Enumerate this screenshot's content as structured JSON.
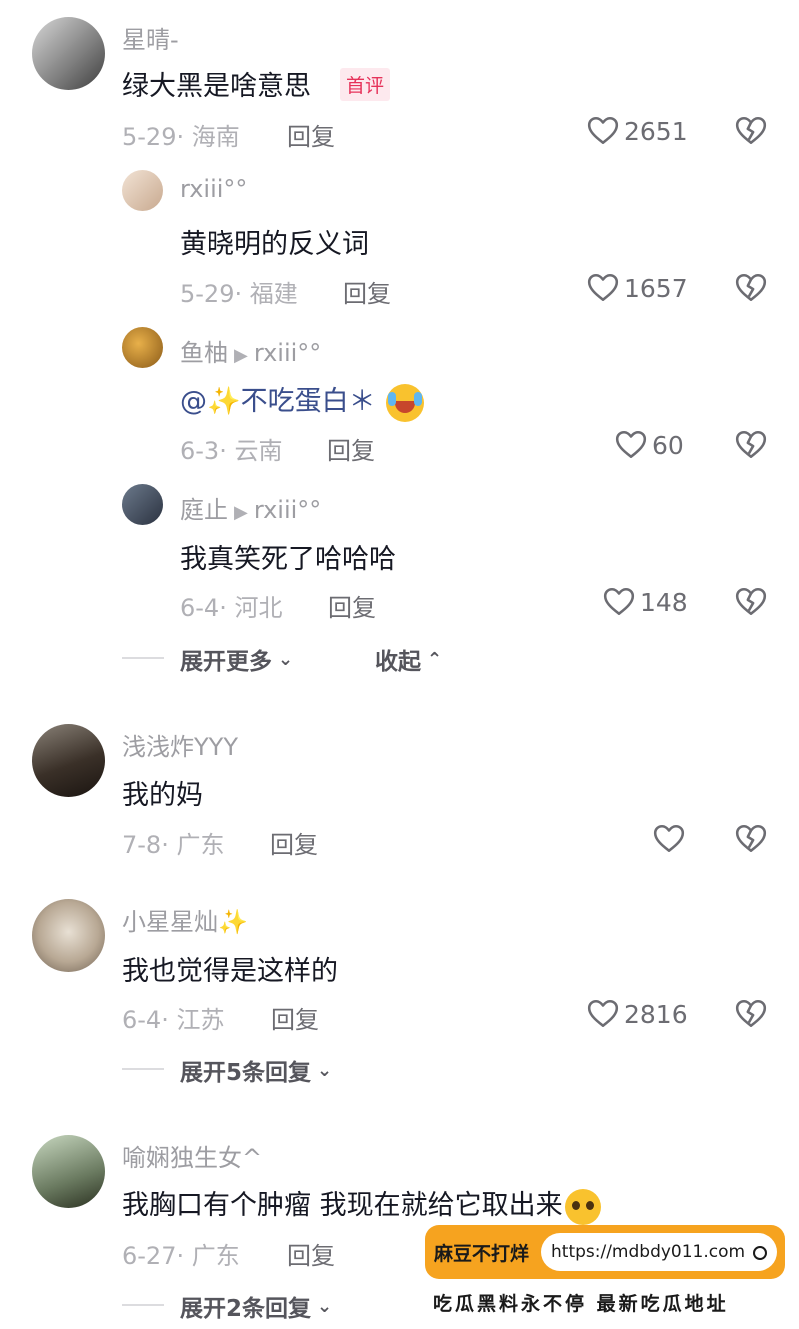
{
  "colors": {
    "accent": "#e6325a",
    "mention": "#3a4e8c",
    "watermark_orange": "#f6a31f"
  },
  "comments": [
    {
      "user": "星晴-",
      "text": "绿大黑是啥意思",
      "tag": "首评",
      "date": "5-29",
      "location": "海南",
      "reply": "回复",
      "likes": "2651"
    },
    {
      "user": "rxiii°°",
      "text": "黄晓明的反义词",
      "date": "5-29",
      "location": "福建",
      "reply": "回复",
      "likes": "1657"
    },
    {
      "user": "鱼柚",
      "reply_to": "rxiii°°",
      "mention": "@✨不吃蛋白＊",
      "date": "6-3",
      "location": "云南",
      "reply": "回复",
      "likes": "60"
    },
    {
      "user": "庭止",
      "reply_to": "rxiii°°",
      "text": "我真笑死了哈哈哈",
      "date": "6-4",
      "location": "河北",
      "reply": "回复",
      "likes": "148"
    },
    {
      "user": "浅浅炸YYY",
      "text": "我的妈",
      "date": "7-8",
      "location": "广东",
      "reply": "回复",
      "likes": ""
    },
    {
      "user": "小星星灿✨",
      "text": "我也觉得是这样的",
      "date": "6-4",
      "location": "江苏",
      "reply": "回复",
      "likes": "2816"
    },
    {
      "user": "喻娴独生女^",
      "text": "我胸口有个肿瘤 我现在就给它取出来",
      "date": "6-27",
      "location": "广东",
      "reply": "回复",
      "likes": ""
    }
  ],
  "expand1": {
    "more": "展开更多",
    "collapse": "收起"
  },
  "expand2": {
    "label": "展开5条回复"
  },
  "expand3": {
    "label": "展开2条回复"
  },
  "watermark": {
    "brand": "麻豆不打烊",
    "url": "https://mdbdy011.com",
    "slogan": "吃瓜黑料永不停 最新吃瓜地址"
  }
}
